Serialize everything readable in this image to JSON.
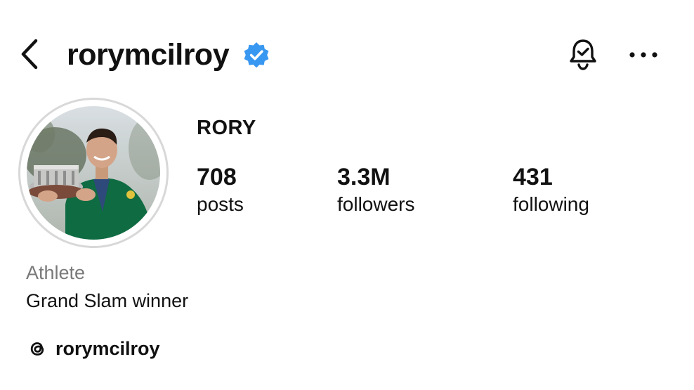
{
  "header": {
    "username": "rorymcilroy",
    "verified_color": "#3897f0",
    "icons": [
      "back-icon",
      "verified-badge-icon",
      "bell-notification-icon",
      "more-options-icon"
    ]
  },
  "profile": {
    "display_name": "RORY",
    "stats": [
      {
        "value": "708",
        "label": "posts"
      },
      {
        "value": "3.3M",
        "label": "followers"
      },
      {
        "value": "431",
        "label": "following"
      }
    ],
    "category": "Athlete",
    "bio": "Grand Slam winner",
    "threads_handle": "rorymcilroy"
  }
}
